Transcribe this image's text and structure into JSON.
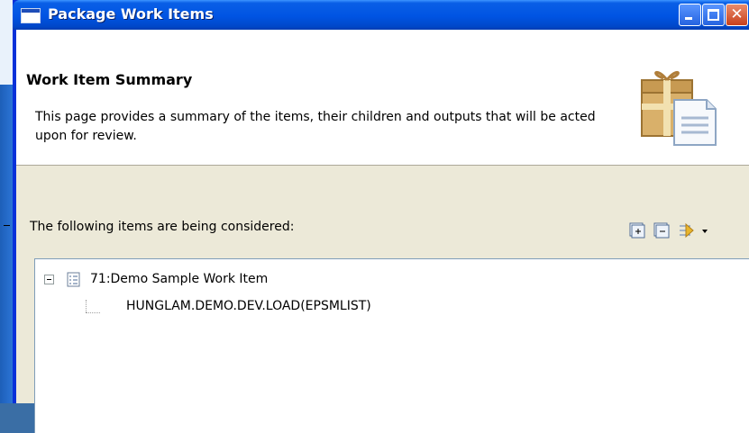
{
  "window": {
    "title": "Package Work Items"
  },
  "banner": {
    "title": "Work Item Summary",
    "description": "This page provides a summary of the items, their children and outputs that will be acted upon for review."
  },
  "items_section": {
    "label": "The following items are being considered:",
    "toolbar": [
      "expand-all-icon",
      "collapse-all-icon",
      "filter-menu-icon"
    ]
  },
  "tree": {
    "items": [
      {
        "label": "71:Demo Sample Work Item",
        "icon": "work-item-icon",
        "expanded": true,
        "children": [
          {
            "label": "HUNGLAM.DEMO.DEV.LOAD(EPSMLIST)"
          }
        ]
      }
    ]
  }
}
